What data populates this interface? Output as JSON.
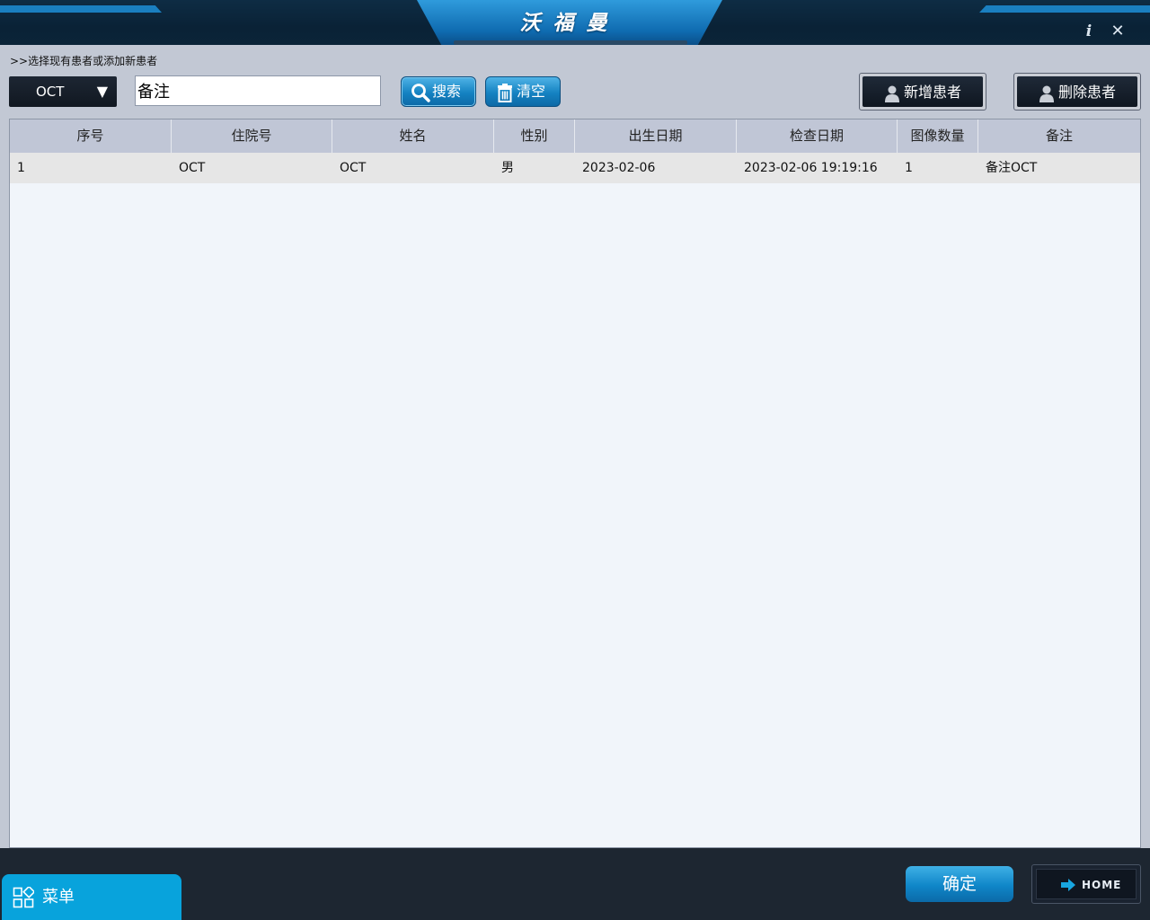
{
  "app": {
    "title": "沃福曼"
  },
  "instruction": ">>选择现有患者或添加新患者",
  "filter": {
    "type_value": "OCT",
    "search_value": "备注"
  },
  "buttons": {
    "search": "搜索",
    "clear": "清空",
    "add_patient": "新增患者",
    "delete_patient": "删除患者",
    "confirm": "确定",
    "home": "HOME",
    "menu": "菜单"
  },
  "table": {
    "headers": [
      "序号",
      "住院号",
      "姓名",
      "性别",
      "出生日期",
      "检查日期",
      "图像数量",
      "备注"
    ],
    "rows": [
      [
        "1",
        "OCT",
        "OCT",
        "男",
        "2023-02-06",
        "2023-02-06 19:19:16",
        "1",
        "备注OCT"
      ]
    ]
  },
  "colors": {
    "accent": "#08a3dc",
    "titlebar": "#0b2438",
    "dark_panel": "#1d2631"
  },
  "icons": {
    "info": "i",
    "close": "✕",
    "dropdown": "▼"
  }
}
